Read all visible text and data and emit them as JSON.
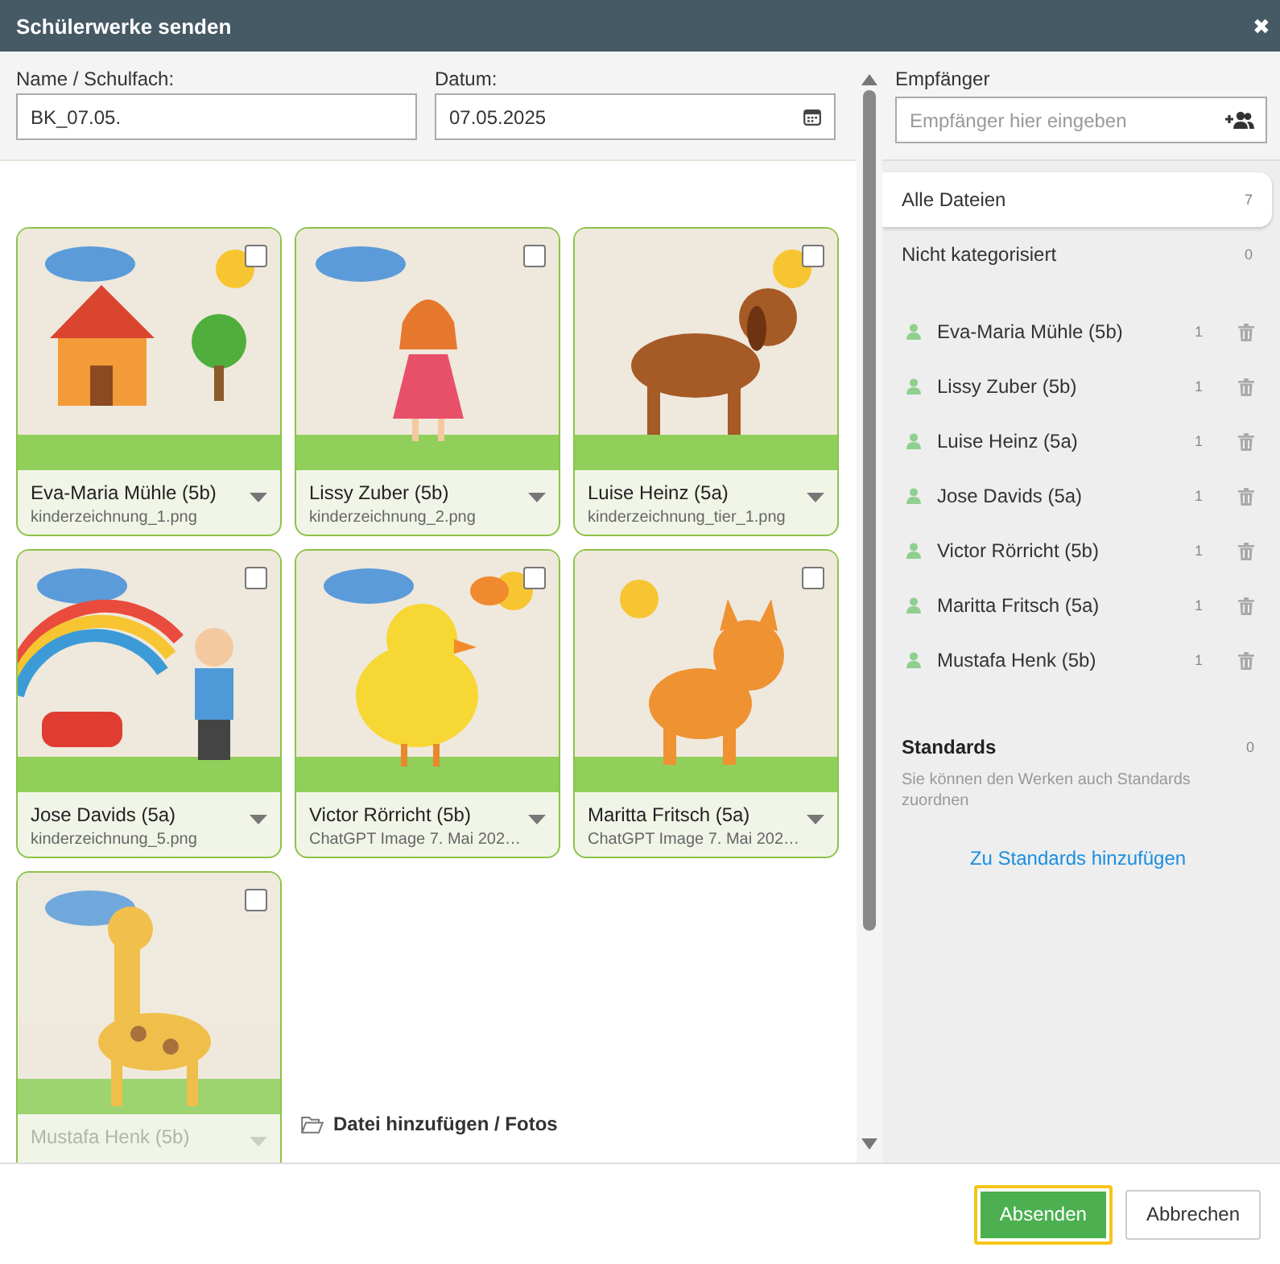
{
  "window": {
    "title": "Schülerwerke senden",
    "close": "✖"
  },
  "form": {
    "name_label": "Name / Schulfach:",
    "name_value": "BK_07.05.",
    "date_label": "Datum:",
    "date_value": "07.05.2025"
  },
  "works": [
    {
      "student": "Eva-Maria Mühle (5b)",
      "file": "kinderzeichnung_1.png",
      "checked": false,
      "faded": false
    },
    {
      "student": "Lissy Zuber (5b)",
      "file": "kinderzeichnung_2.png",
      "checked": false,
      "faded": false
    },
    {
      "student": "Luise Heinz (5a)",
      "file": "kinderzeichnung_tier_1.png",
      "checked": false,
      "faded": false
    },
    {
      "student": "Jose Davids (5a)",
      "file": "kinderzeichnung_5.png",
      "checked": false,
      "faded": false
    },
    {
      "student": "Victor Rörricht (5b)",
      "file": "ChatGPT Image 7. Mai 202…",
      "checked": false,
      "faded": false
    },
    {
      "student": "Maritta Fritsch (5a)",
      "file": "ChatGPT Image 7. Mai 202…",
      "checked": false,
      "faded": false
    },
    {
      "student": "Mustafa Henk (5b)",
      "checked": false,
      "faded": true
    }
  ],
  "add_files": "Datei hinzufügen / Fotos",
  "recipients": {
    "label": "Empfänger",
    "placeholder": "Empfänger hier eingeben"
  },
  "categories": [
    {
      "label": "Alle Dateien",
      "count": "7",
      "selected": true
    },
    {
      "label": "Nicht kategorisiert",
      "count": "0",
      "selected": false
    }
  ],
  "students": [
    {
      "name": "Eva-Maria Mühle (5b)",
      "count": "1"
    },
    {
      "name": "Lissy Zuber (5b)",
      "count": "1"
    },
    {
      "name": "Luise Heinz (5a)",
      "count": "1"
    },
    {
      "name": "Jose Davids (5a)",
      "count": "1"
    },
    {
      "name": "Victor Rörricht (5b)",
      "count": "1"
    },
    {
      "name": "Maritta Fritsch (5a)",
      "count": "1"
    },
    {
      "name": "Mustafa Henk (5b)",
      "count": "1"
    }
  ],
  "standards": {
    "title": "Standards",
    "count": "0",
    "hint": "Sie können den Werken auch Standards zuordnen",
    "link": "Zu Standards hinzufügen"
  },
  "buttons": [
    {
      "label": "Absenden",
      "kind": "primary",
      "focused": true
    },
    {
      "label": "Abbrechen",
      "kind": "secondary",
      "focused": false
    }
  ]
}
